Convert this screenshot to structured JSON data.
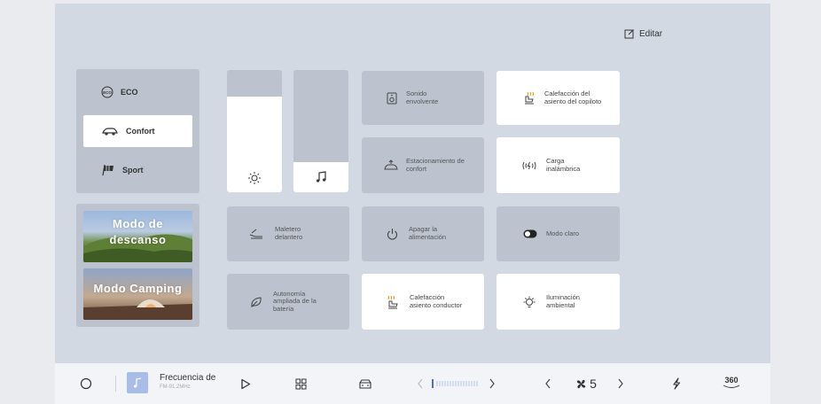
{
  "header": {
    "edit_label": "Editar"
  },
  "modes": [
    {
      "label": "ECO",
      "icon": "eco-icon",
      "active": false
    },
    {
      "label": "Confort",
      "icon": "car-comfort-icon",
      "active": true
    },
    {
      "label": "Sport",
      "icon": "sport-flag-icon",
      "active": false
    }
  ],
  "scenes": [
    {
      "label": "Modo de descanso"
    },
    {
      "label": "Modo Camping"
    }
  ],
  "sliders": {
    "brightness": {
      "icon": "sun-icon",
      "level": 0.78
    },
    "volume": {
      "icon": "music-note-icon",
      "level": 0.25
    }
  },
  "tiles": {
    "sonido": "Sonido envolvente",
    "calef_copiloto": "Calefacción del asiento del copiloto",
    "estacionamiento": "Estacionamiento de confort",
    "carga": "Carga inalámbrica",
    "maletero": "Maletero delantero",
    "apagar": "Apagar la alimentación",
    "modo_claro": "Modo claro",
    "autonomia": "Autonomía ampliada de la batería",
    "calef_conductor": "Calefacción asiento conductor",
    "iluminacion": "Iluminación ambiental"
  },
  "bottombar": {
    "radio_title": "Frecuencia de",
    "radio_sub": "FM-91.2MHz",
    "fan_speed": "5",
    "view_360": "360"
  },
  "colors": {
    "screen_bg": "#d3d9e3",
    "tile_gray": "#bcc3ce",
    "tile_white": "#ffffff",
    "accent_blue": "#a8bde8"
  }
}
